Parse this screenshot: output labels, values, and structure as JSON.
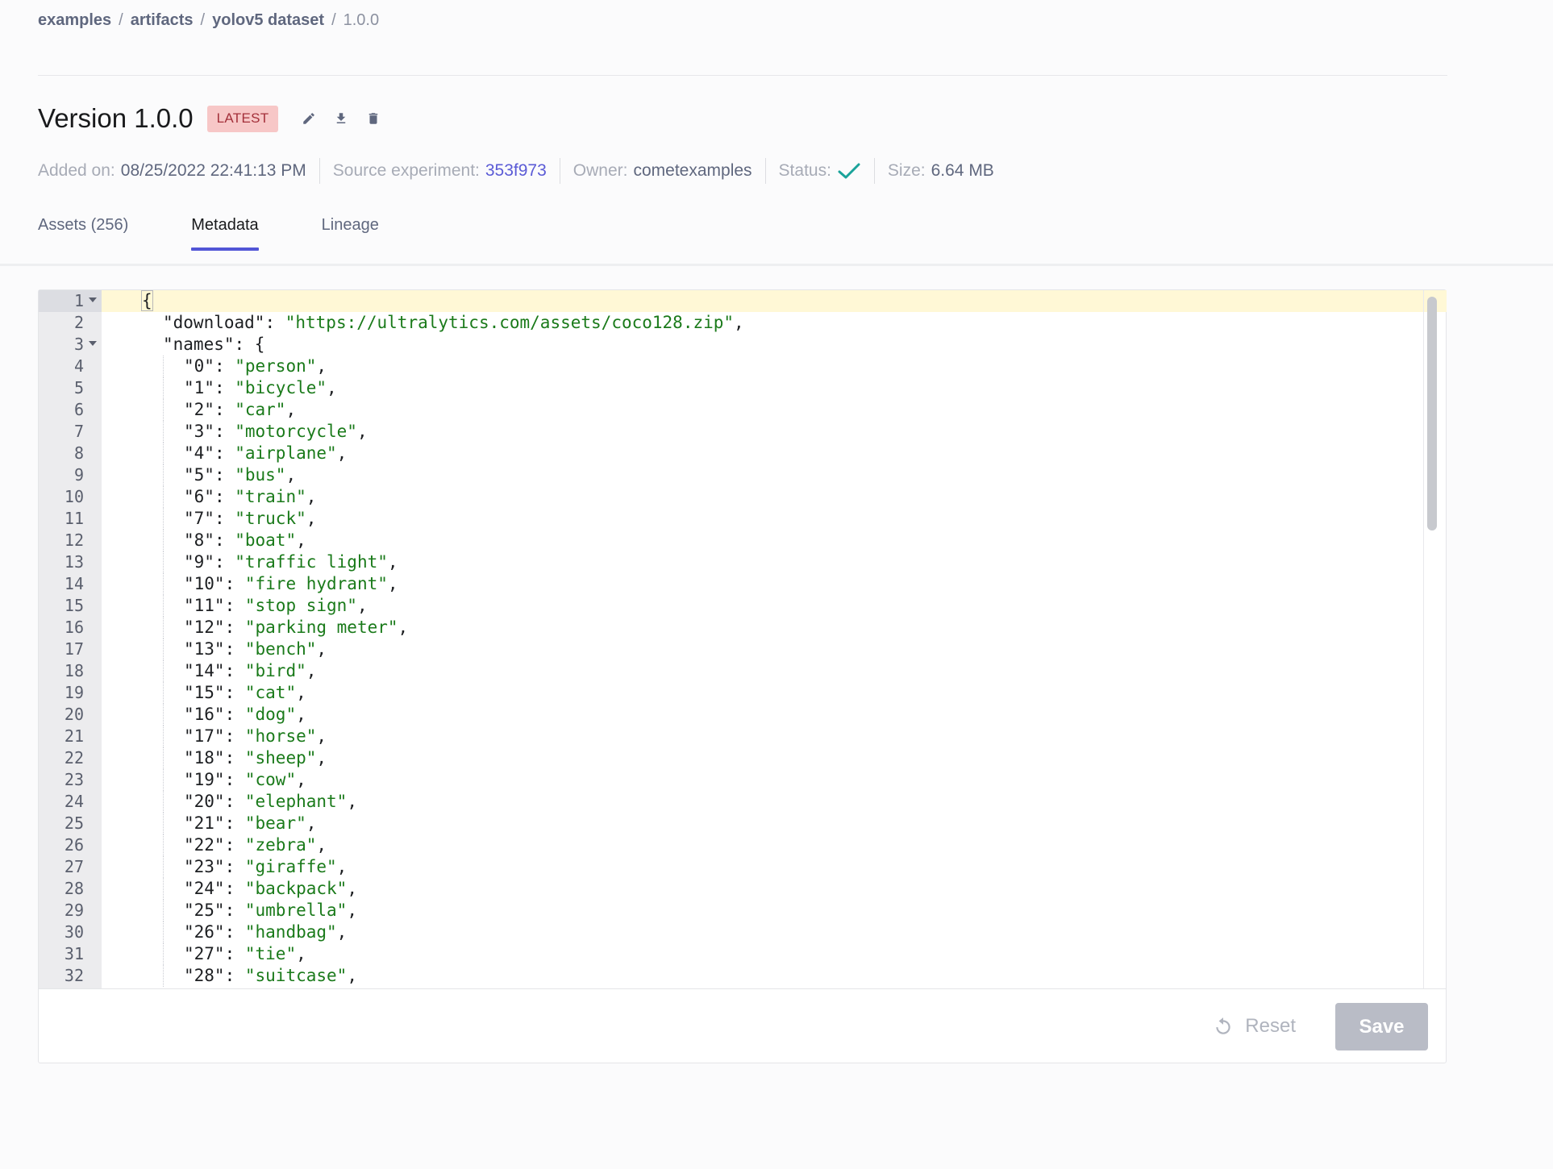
{
  "breadcrumb": {
    "workspace": "examples",
    "section": "artifacts",
    "artifact": "yolov5 dataset",
    "version": "1.0.0",
    "separator": "/"
  },
  "header": {
    "title": "Version 1.0.0",
    "badge": "LATEST"
  },
  "actions": {
    "icons": [
      "edit-icon",
      "download-icon",
      "delete-icon"
    ]
  },
  "meta": {
    "added_label": "Added on:",
    "added_value": "08/25/2022 22:41:13 PM",
    "source_label": "Source experiment:",
    "source_value": "353f973",
    "owner_label": "Owner:",
    "owner_value": "cometexamples",
    "status_label": "Status:",
    "status_icon": "check-icon",
    "size_label": "Size:",
    "size_value": "6.64 MB"
  },
  "tabs": [
    {
      "label": "Assets (256)",
      "active": false
    },
    {
      "label": "Metadata",
      "active": true
    },
    {
      "label": "Lineage",
      "active": false
    }
  ],
  "editor": {
    "lines": [
      {
        "n": "1",
        "fold": true,
        "indent": 0,
        "parts": [
          [
            "punc",
            "{"
          ]
        ]
      },
      {
        "n": "2",
        "indent": 1,
        "parts": [
          [
            "key",
            "\"download\""
          ],
          [
            "punc",
            ": "
          ],
          [
            "str",
            "\"https://ultralytics.com/assets/coco128.zip\""
          ],
          [
            "punc",
            ","
          ]
        ]
      },
      {
        "n": "3",
        "fold": true,
        "indent": 1,
        "parts": [
          [
            "key",
            "\"names\""
          ],
          [
            "punc",
            ": {"
          ]
        ]
      },
      {
        "n": "4",
        "indent": 2,
        "parts": [
          [
            "key",
            "\"0\""
          ],
          [
            "punc",
            ": "
          ],
          [
            "str",
            "\"person\""
          ],
          [
            "punc",
            ","
          ]
        ]
      },
      {
        "n": "5",
        "indent": 2,
        "parts": [
          [
            "key",
            "\"1\""
          ],
          [
            "punc",
            ": "
          ],
          [
            "str",
            "\"bicycle\""
          ],
          [
            "punc",
            ","
          ]
        ]
      },
      {
        "n": "6",
        "indent": 2,
        "parts": [
          [
            "key",
            "\"2\""
          ],
          [
            "punc",
            ": "
          ],
          [
            "str",
            "\"car\""
          ],
          [
            "punc",
            ","
          ]
        ]
      },
      {
        "n": "7",
        "indent": 2,
        "parts": [
          [
            "key",
            "\"3\""
          ],
          [
            "punc",
            ": "
          ],
          [
            "str",
            "\"motorcycle\""
          ],
          [
            "punc",
            ","
          ]
        ]
      },
      {
        "n": "8",
        "indent": 2,
        "parts": [
          [
            "key",
            "\"4\""
          ],
          [
            "punc",
            ": "
          ],
          [
            "str",
            "\"airplane\""
          ],
          [
            "punc",
            ","
          ]
        ]
      },
      {
        "n": "9",
        "indent": 2,
        "parts": [
          [
            "key",
            "\"5\""
          ],
          [
            "punc",
            ": "
          ],
          [
            "str",
            "\"bus\""
          ],
          [
            "punc",
            ","
          ]
        ]
      },
      {
        "n": "10",
        "indent": 2,
        "parts": [
          [
            "key",
            "\"6\""
          ],
          [
            "punc",
            ": "
          ],
          [
            "str",
            "\"train\""
          ],
          [
            "punc",
            ","
          ]
        ]
      },
      {
        "n": "11",
        "indent": 2,
        "parts": [
          [
            "key",
            "\"7\""
          ],
          [
            "punc",
            ": "
          ],
          [
            "str",
            "\"truck\""
          ],
          [
            "punc",
            ","
          ]
        ]
      },
      {
        "n": "12",
        "indent": 2,
        "parts": [
          [
            "key",
            "\"8\""
          ],
          [
            "punc",
            ": "
          ],
          [
            "str",
            "\"boat\""
          ],
          [
            "punc",
            ","
          ]
        ]
      },
      {
        "n": "13",
        "indent": 2,
        "parts": [
          [
            "key",
            "\"9\""
          ],
          [
            "punc",
            ": "
          ],
          [
            "str",
            "\"traffic light\""
          ],
          [
            "punc",
            ","
          ]
        ]
      },
      {
        "n": "14",
        "indent": 2,
        "parts": [
          [
            "key",
            "\"10\""
          ],
          [
            "punc",
            ": "
          ],
          [
            "str",
            "\"fire hydrant\""
          ],
          [
            "punc",
            ","
          ]
        ]
      },
      {
        "n": "15",
        "indent": 2,
        "parts": [
          [
            "key",
            "\"11\""
          ],
          [
            "punc",
            ": "
          ],
          [
            "str",
            "\"stop sign\""
          ],
          [
            "punc",
            ","
          ]
        ]
      },
      {
        "n": "16",
        "indent": 2,
        "parts": [
          [
            "key",
            "\"12\""
          ],
          [
            "punc",
            ": "
          ],
          [
            "str",
            "\"parking meter\""
          ],
          [
            "punc",
            ","
          ]
        ]
      },
      {
        "n": "17",
        "indent": 2,
        "parts": [
          [
            "key",
            "\"13\""
          ],
          [
            "punc",
            ": "
          ],
          [
            "str",
            "\"bench\""
          ],
          [
            "punc",
            ","
          ]
        ]
      },
      {
        "n": "18",
        "indent": 2,
        "parts": [
          [
            "key",
            "\"14\""
          ],
          [
            "punc",
            ": "
          ],
          [
            "str",
            "\"bird\""
          ],
          [
            "punc",
            ","
          ]
        ]
      },
      {
        "n": "19",
        "indent": 2,
        "parts": [
          [
            "key",
            "\"15\""
          ],
          [
            "punc",
            ": "
          ],
          [
            "str",
            "\"cat\""
          ],
          [
            "punc",
            ","
          ]
        ]
      },
      {
        "n": "20",
        "indent": 2,
        "parts": [
          [
            "key",
            "\"16\""
          ],
          [
            "punc",
            ": "
          ],
          [
            "str",
            "\"dog\""
          ],
          [
            "punc",
            ","
          ]
        ]
      },
      {
        "n": "21",
        "indent": 2,
        "parts": [
          [
            "key",
            "\"17\""
          ],
          [
            "punc",
            ": "
          ],
          [
            "str",
            "\"horse\""
          ],
          [
            "punc",
            ","
          ]
        ]
      },
      {
        "n": "22",
        "indent": 2,
        "parts": [
          [
            "key",
            "\"18\""
          ],
          [
            "punc",
            ": "
          ],
          [
            "str",
            "\"sheep\""
          ],
          [
            "punc",
            ","
          ]
        ]
      },
      {
        "n": "23",
        "indent": 2,
        "parts": [
          [
            "key",
            "\"19\""
          ],
          [
            "punc",
            ": "
          ],
          [
            "str",
            "\"cow\""
          ],
          [
            "punc",
            ","
          ]
        ]
      },
      {
        "n": "24",
        "indent": 2,
        "parts": [
          [
            "key",
            "\"20\""
          ],
          [
            "punc",
            ": "
          ],
          [
            "str",
            "\"elephant\""
          ],
          [
            "punc",
            ","
          ]
        ]
      },
      {
        "n": "25",
        "indent": 2,
        "parts": [
          [
            "key",
            "\"21\""
          ],
          [
            "punc",
            ": "
          ],
          [
            "str",
            "\"bear\""
          ],
          [
            "punc",
            ","
          ]
        ]
      },
      {
        "n": "26",
        "indent": 2,
        "parts": [
          [
            "key",
            "\"22\""
          ],
          [
            "punc",
            ": "
          ],
          [
            "str",
            "\"zebra\""
          ],
          [
            "punc",
            ","
          ]
        ]
      },
      {
        "n": "27",
        "indent": 2,
        "parts": [
          [
            "key",
            "\"23\""
          ],
          [
            "punc",
            ": "
          ],
          [
            "str",
            "\"giraffe\""
          ],
          [
            "punc",
            ","
          ]
        ]
      },
      {
        "n": "28",
        "indent": 2,
        "parts": [
          [
            "key",
            "\"24\""
          ],
          [
            "punc",
            ": "
          ],
          [
            "str",
            "\"backpack\""
          ],
          [
            "punc",
            ","
          ]
        ]
      },
      {
        "n": "29",
        "indent": 2,
        "parts": [
          [
            "key",
            "\"25\""
          ],
          [
            "punc",
            ": "
          ],
          [
            "str",
            "\"umbrella\""
          ],
          [
            "punc",
            ","
          ]
        ]
      },
      {
        "n": "30",
        "indent": 2,
        "parts": [
          [
            "key",
            "\"26\""
          ],
          [
            "punc",
            ": "
          ],
          [
            "str",
            "\"handbag\""
          ],
          [
            "punc",
            ","
          ]
        ]
      },
      {
        "n": "31",
        "indent": 2,
        "parts": [
          [
            "key",
            "\"27\""
          ],
          [
            "punc",
            ": "
          ],
          [
            "str",
            "\"tie\""
          ],
          [
            "punc",
            ","
          ]
        ]
      },
      {
        "n": "32",
        "indent": 2,
        "parts": [
          [
            "key",
            "\"28\""
          ],
          [
            "punc",
            ": "
          ],
          [
            "str",
            "\"suitcase\""
          ],
          [
            "punc",
            ","
          ]
        ]
      }
    ]
  },
  "footer": {
    "reset_label": "Reset",
    "save_label": "Save"
  },
  "colors": {
    "accent": "#5155d6",
    "link": "#5b5bd6",
    "badge_bg": "#f7c7c7",
    "badge_text": "#a3303a",
    "string": "#1a7a1a",
    "status_ok": "#1aa39a"
  }
}
